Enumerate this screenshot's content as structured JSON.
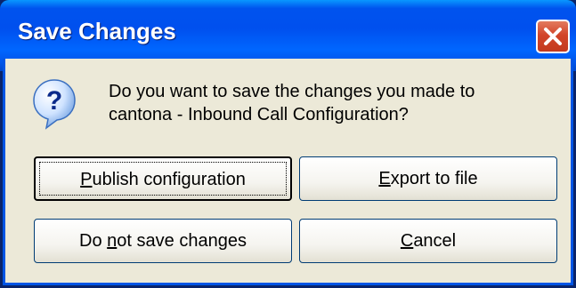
{
  "window": {
    "title": "Save Changes",
    "close_icon": "close-icon"
  },
  "message": {
    "icon": "question-icon",
    "line1": "Do you want to save the changes you made to",
    "line2": "cantona - Inbound Call Configuration?"
  },
  "buttons": {
    "publish": {
      "before": "",
      "mnemonic": "P",
      "after": "ublish configuration",
      "is_default": true
    },
    "export": {
      "before": "",
      "mnemonic": "E",
      "after": "xport to file"
    },
    "no_save": {
      "before": "Do ",
      "mnemonic": "n",
      "after": "ot save changes"
    },
    "cancel": {
      "before": "",
      "mnemonic": "C",
      "after": "ancel"
    }
  },
  "colors": {
    "titlebar": "#0055ea",
    "dialog_face": "#ece9d8",
    "close_button": "#d2452a"
  }
}
